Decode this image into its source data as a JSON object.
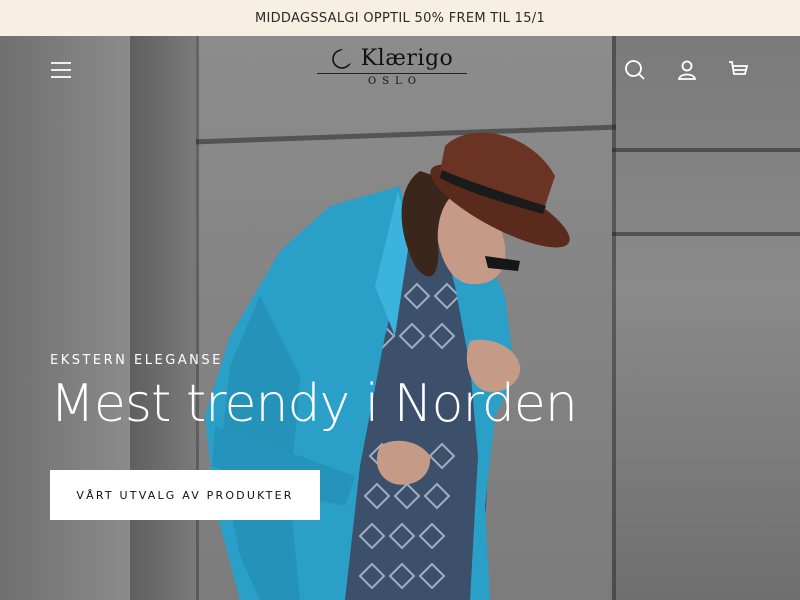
{
  "announcement": {
    "text": "MIDDAGSSALGI OPPTIL 50% FREM TIL 15/1"
  },
  "header": {
    "logo": {
      "name": "Klærigo",
      "subtitle": "OSLO"
    },
    "icons": [
      "menu-icon",
      "search-icon",
      "account-icon",
      "cart-icon"
    ]
  },
  "hero": {
    "eyebrow": "EKSTERN ELEGANSE",
    "headline": "Mest trendy i Norden",
    "cta_label": "VÅRT UTVALG AV PRODUKTER"
  },
  "colors": {
    "announcement_bg": "#f7efe1",
    "blazer": "#2a9fc8",
    "hat": "#5a2a1c",
    "cta_bg": "#ffffff"
  }
}
